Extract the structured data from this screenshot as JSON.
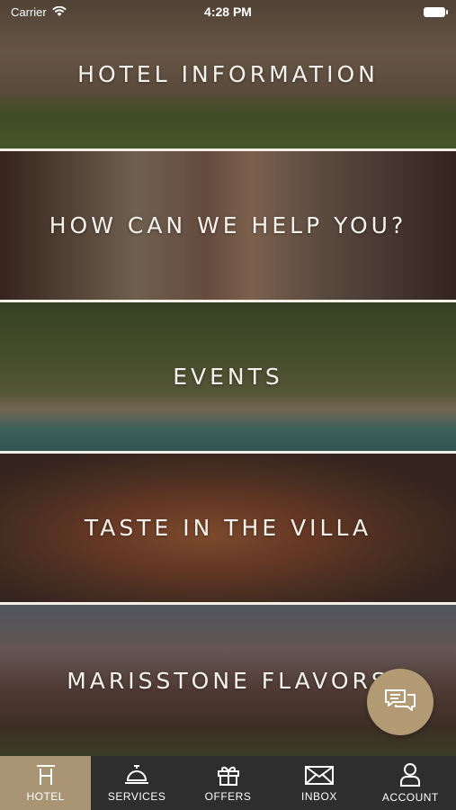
{
  "status_bar": {
    "carrier": "Carrier",
    "time": "4:28 PM"
  },
  "tiles": [
    {
      "label": "HOTEL INFORMATION"
    },
    {
      "label": "HOW CAN WE HELP YOU?"
    },
    {
      "label": "EVENTS"
    },
    {
      "label": "TASTE IN THE VILLA"
    },
    {
      "label": "MARISSTONE FLAVORS"
    }
  ],
  "chat_button": {
    "icon": "chat-bubbles-icon"
  },
  "tabbar": {
    "active": "HOTEL",
    "items": [
      {
        "label": "HOTEL",
        "icon": "hotel-h-icon"
      },
      {
        "label": "SERVICES",
        "icon": "service-bell-icon"
      },
      {
        "label": "OFFERS",
        "icon": "gift-icon"
      },
      {
        "label": "INBOX",
        "icon": "envelope-icon"
      },
      {
        "label": "ACCOUNT",
        "icon": "person-icon"
      }
    ]
  },
  "colors": {
    "accent": "#a99573",
    "tabbar_bg": "#2e2e2e",
    "label_text": "#f6f1ea"
  }
}
